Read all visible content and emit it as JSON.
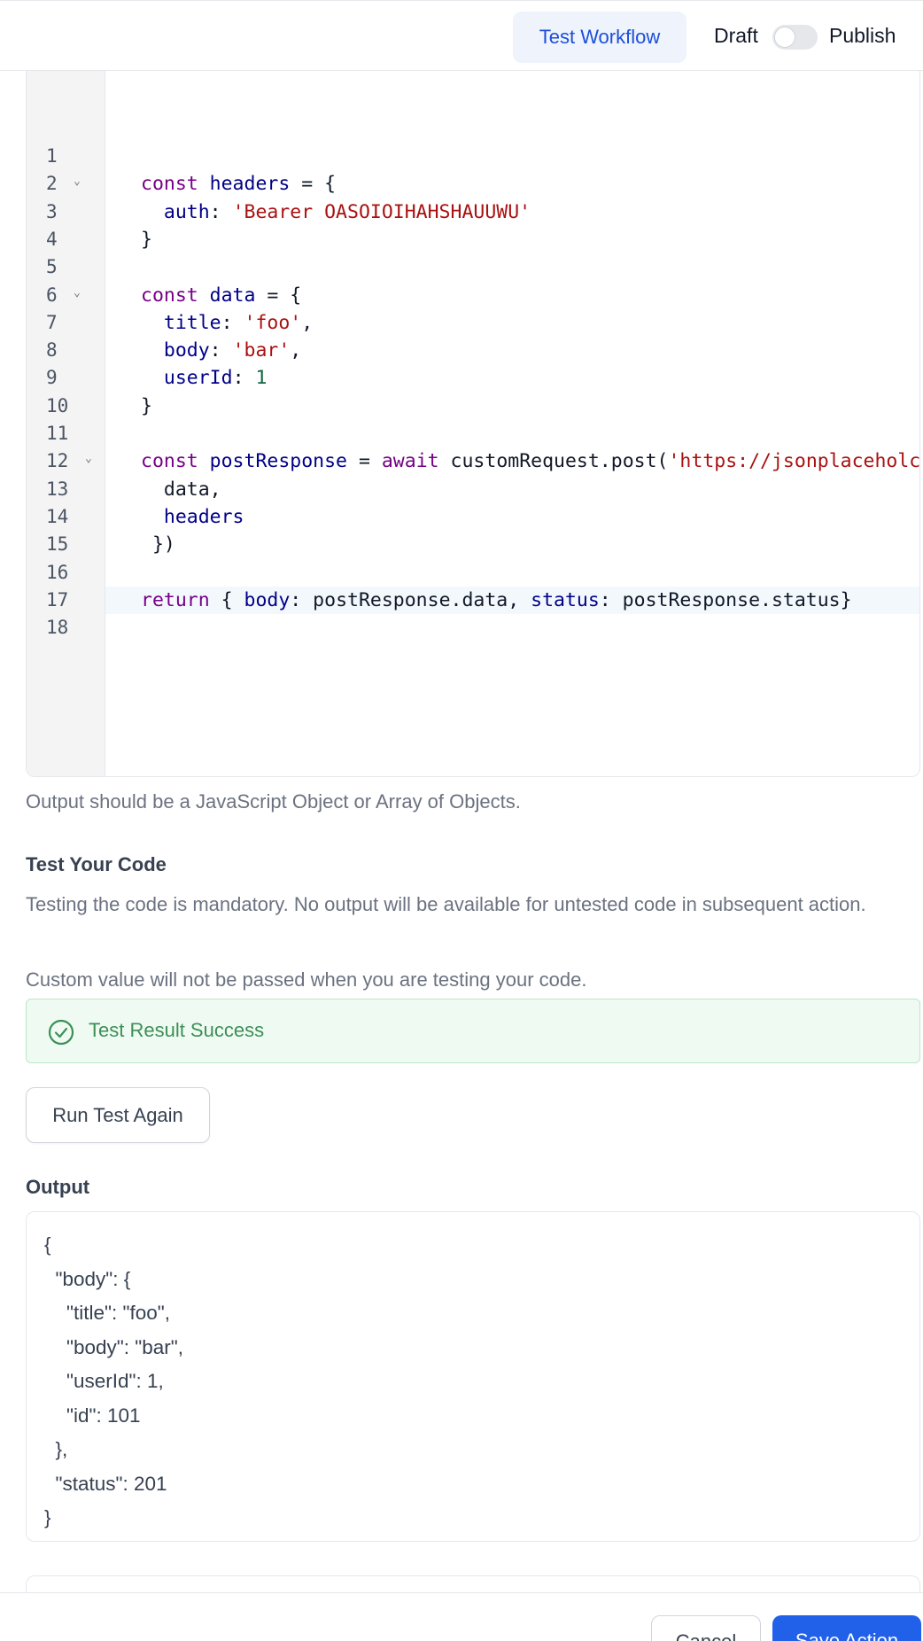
{
  "header": {
    "test_workflow_label": "Test Workflow",
    "draft_label": "Draft",
    "publish_label": "Publish",
    "publish_toggle_on": false
  },
  "editor": {
    "line_numbers": [
      "1",
      "2",
      "3",
      "4",
      "5",
      "6",
      "7",
      "8",
      "9",
      "10",
      "11",
      "12",
      "13",
      "14",
      "15",
      "16",
      "17",
      "18"
    ],
    "folded_lines": [
      "2",
      "6",
      "12"
    ],
    "active_line": "17",
    "lines": [
      [],
      [
        {
          "t": "kw",
          "v": "const "
        },
        {
          "t": "var",
          "v": "headers"
        },
        {
          "t": "p",
          "v": " = {"
        }
      ],
      [
        {
          "t": "p",
          "v": "  "
        },
        {
          "t": "var",
          "v": "auth"
        },
        {
          "t": "p",
          "v": ": "
        },
        {
          "t": "str",
          "v": "'Bearer OASOIOIHAHSHAUUWU'"
        }
      ],
      [
        {
          "t": "p",
          "v": "}"
        }
      ],
      [],
      [
        {
          "t": "kw",
          "v": "const "
        },
        {
          "t": "var",
          "v": "data"
        },
        {
          "t": "p",
          "v": " = {"
        }
      ],
      [
        {
          "t": "p",
          "v": "  "
        },
        {
          "t": "var",
          "v": "title"
        },
        {
          "t": "p",
          "v": ": "
        },
        {
          "t": "str",
          "v": "'foo'"
        },
        {
          "t": "p",
          "v": ","
        }
      ],
      [
        {
          "t": "p",
          "v": "  "
        },
        {
          "t": "var",
          "v": "body"
        },
        {
          "t": "p",
          "v": ": "
        },
        {
          "t": "str",
          "v": "'bar'"
        },
        {
          "t": "p",
          "v": ","
        }
      ],
      [
        {
          "t": "p",
          "v": "  "
        },
        {
          "t": "var",
          "v": "userId"
        },
        {
          "t": "p",
          "v": ": "
        },
        {
          "t": "num",
          "v": "1"
        }
      ],
      [
        {
          "t": "p",
          "v": "}"
        }
      ],
      [],
      [
        {
          "t": "kw",
          "v": "const "
        },
        {
          "t": "var",
          "v": "postResponse"
        },
        {
          "t": "p",
          "v": " = "
        },
        {
          "t": "kw",
          "v": "await"
        },
        {
          "t": "p",
          "v": " customRequest.post("
        },
        {
          "t": "str",
          "v": "'https://jsonplaceholc"
        }
      ],
      [
        {
          "t": "p",
          "v": "  data,"
        }
      ],
      [
        {
          "t": "p",
          "v": "  "
        },
        {
          "t": "var",
          "v": "headers"
        }
      ],
      [
        {
          "t": "p",
          "v": " })"
        }
      ],
      [],
      [
        {
          "t": "kw",
          "v": "return"
        },
        {
          "t": "p",
          "v": " { "
        },
        {
          "t": "var",
          "v": "body"
        },
        {
          "t": "p",
          "v": ": postResponse.data, "
        },
        {
          "t": "var",
          "v": "status"
        },
        {
          "t": "p",
          "v": ": postResponse.status}"
        }
      ],
      []
    ]
  },
  "hint_text": "Output should be a JavaScript Object or Array of Objects.",
  "test_section": {
    "title": "Test Your Code",
    "desc1": "Testing the code is mandatory. No output will be available for untested code in subsequent action.",
    "desc2": "Custom value will not be passed when you are testing your code.",
    "success_text": "Test Result Success",
    "run_again_label": "Run Test Again"
  },
  "output": {
    "title": "Output",
    "lines": [
      "{",
      "  \"body\": {",
      "    \"title\": \"foo\",",
      "    \"body\": \"bar\",",
      "    \"userId\": 1,",
      "    \"id\": 101",
      "  },",
      "  \"status\": 201",
      "}"
    ]
  },
  "footer": {
    "cancel_label": "Cancel",
    "save_label": "Save Action"
  },
  "colors": {
    "accent": "#2160e8",
    "success_text": "#3d8f57",
    "success_bg": "#effbf2"
  }
}
